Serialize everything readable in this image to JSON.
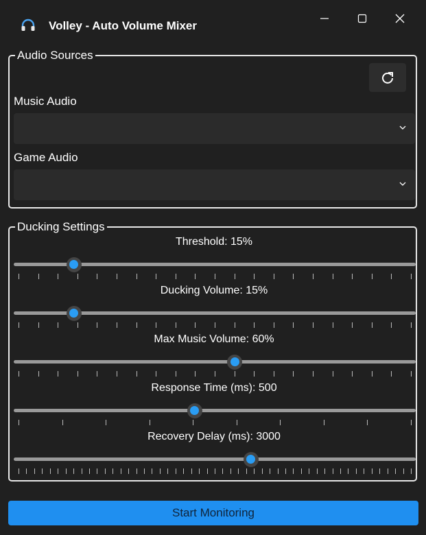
{
  "window": {
    "title": "Volley - Auto Volume Mixer",
    "icon": "headphones-icon",
    "controls": [
      "minimize-icon",
      "maximize-icon",
      "close-icon"
    ]
  },
  "audio_sources": {
    "legend": "Audio Sources",
    "refresh_icon": "refresh-icon",
    "music_label": "Music Audio",
    "music_value": "",
    "game_label": "Game Audio",
    "game_value": ""
  },
  "ducking": {
    "legend": "Ducking Settings",
    "sliders": [
      {
        "label": "Threshold: 15%",
        "value_fraction": 0.15,
        "tick_count": 21
      },
      {
        "label": "Ducking Volume: 15%",
        "value_fraction": 0.15,
        "tick_count": 21
      },
      {
        "label": "Max Music Volume: 60%",
        "value_fraction": 0.55,
        "tick_count": 21
      },
      {
        "label": "Response Time (ms): 500",
        "value_fraction": 0.45,
        "tick_count": 10
      },
      {
        "label": "Recovery Delay (ms): 3000",
        "value_fraction": 0.59,
        "tick_count": 51
      }
    ]
  },
  "footer": {
    "start_label": "Start Monitoring"
  },
  "colors": {
    "accent": "#1f8ff0",
    "thumb": "#2a9df4",
    "background": "#202020"
  }
}
